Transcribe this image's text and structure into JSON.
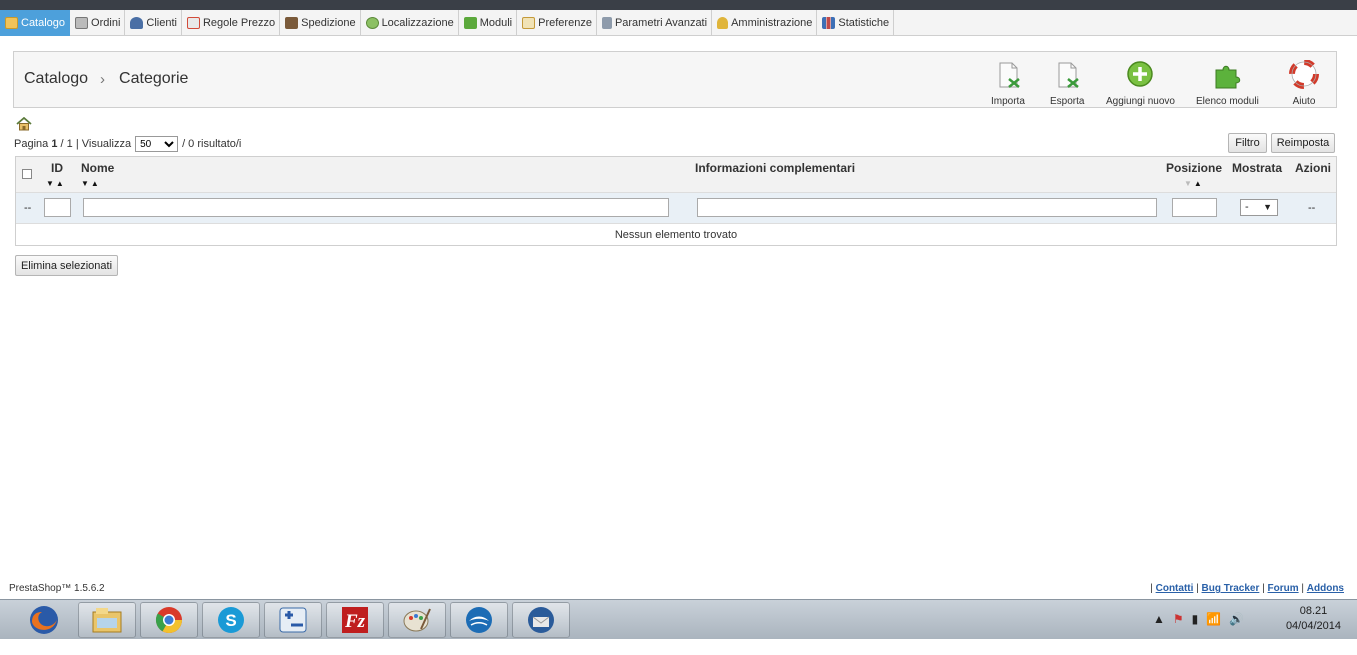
{
  "menu": {
    "tabs": [
      {
        "label": "Catalogo",
        "icon": "folder-icon",
        "color": "#f0b53a"
      },
      {
        "label": "Ordini",
        "icon": "cart-icon",
        "color": "#8a8a8a"
      },
      {
        "label": "Clienti",
        "icon": "user-icon",
        "color": "#4a6fa5"
      },
      {
        "label": "Regole Prezzo",
        "icon": "price-rule-icon",
        "color": "#d24b3a"
      },
      {
        "label": "Spedizione",
        "icon": "truck-icon",
        "color": "#7a5a3a"
      },
      {
        "label": "Localizzazione",
        "icon": "globe-icon",
        "color": "#6aa84f"
      },
      {
        "label": "Moduli",
        "icon": "puzzle-icon",
        "color": "#5ca93c"
      },
      {
        "label": "Preferenze",
        "icon": "preferences-icon",
        "color": "#d6a94a"
      },
      {
        "label": "Parametri Avanzati",
        "icon": "wrench-icon",
        "color": "#6d7b8d"
      },
      {
        "label": "Amministrazione",
        "icon": "key-icon",
        "color": "#e0b53b"
      },
      {
        "label": "Statistiche",
        "icon": "bar-chart-icon",
        "color": "#3d6fb6"
      }
    ]
  },
  "header": {
    "breadcrumb_1": "Catalogo",
    "breadcrumb_sep": "›",
    "breadcrumb_2": "Categorie",
    "toolbar": {
      "import": "Importa",
      "export": "Esporta",
      "add_new": "Aggiungi nuovo",
      "modules_list": "Elenco moduli",
      "help": "Aiuto"
    }
  },
  "pager": {
    "prefix": "Pagina",
    "current": "1",
    "total": "/ 1",
    "pipe": "|",
    "show_label": "Visualizza",
    "per_page": "50",
    "results": "/ 0 risultato/i"
  },
  "filters": {
    "filter_button": "Filtro",
    "reset_button": "Reimposta"
  },
  "table": {
    "columns": {
      "id": "ID",
      "name": "Nome",
      "info": "Informazioni complementari",
      "position": "Posizione",
      "shown": "Mostrata",
      "actions": "Azioni"
    },
    "filter_dash": "--",
    "shown_filter_value": "-",
    "actions_dash": "--",
    "empty_message": "Nessun elemento trovato"
  },
  "delete_selected": "Elimina selezionati",
  "footer": {
    "version": "PrestaShop™ 1.5.6.2",
    "links": [
      "Contatti",
      "Bug Tracker",
      "Forum",
      "Addons"
    ]
  },
  "taskbar": {
    "apps": [
      "firefox-icon",
      "file-explorer-icon",
      "chrome-icon",
      "skype-icon",
      "calculator-icon",
      "filezilla-icon",
      "paint-icon",
      "openoffice-icon",
      "thunderbird-icon"
    ],
    "time": "08.21",
    "date": "04/04/2014"
  }
}
